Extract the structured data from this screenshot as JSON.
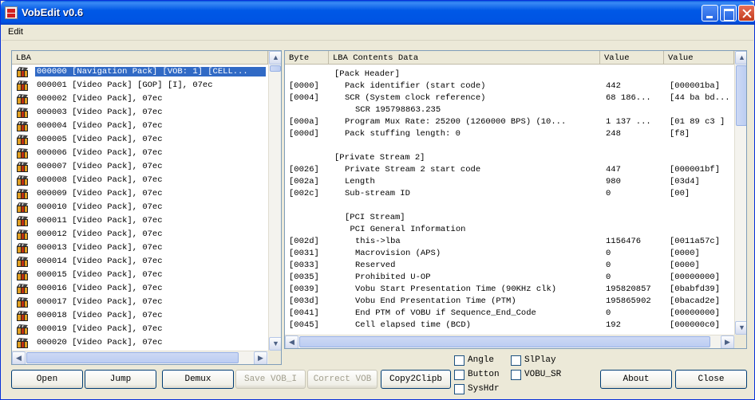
{
  "window": {
    "title": "VobEdit v0.6"
  },
  "menu": {
    "edit": "Edit"
  },
  "lba_panel": {
    "header": "LBA",
    "rows": [
      "000000 [Navigation Pack] [VOB: 1] [CELL...",
      "000001 [Video Pack] [GOP] [I], 07ec",
      "000002 [Video Pack], 07ec",
      "000003 [Video Pack], 07ec",
      "000004 [Video Pack], 07ec",
      "000005 [Video Pack], 07ec",
      "000006 [Video Pack], 07ec",
      "000007 [Video Pack], 07ec",
      "000008 [Video Pack], 07ec",
      "000009 [Video Pack], 07ec",
      "000010 [Video Pack], 07ec",
      "000011 [Video Pack], 07ec",
      "000012 [Video Pack], 07ec",
      "000013 [Video Pack], 07ec",
      "000014 [Video Pack], 07ec",
      "000015 [Video Pack], 07ec",
      "000016 [Video Pack], 07ec",
      "000017 [Video Pack], 07ec",
      "000018 [Video Pack], 07ec",
      "000019 [Video Pack], 07ec",
      "000020 [Video Pack], 07ec"
    ]
  },
  "contents_panel": {
    "headers": {
      "byte": "Byte",
      "contents": "LBA Contents Data",
      "value1": "Value",
      "value2": "Value"
    },
    "rows": [
      {
        "byte": "",
        "content": "[Pack Header]",
        "v1": "",
        "v2": "",
        "indent": 0
      },
      {
        "byte": "[0000]",
        "content": "Pack identifier (start code)",
        "v1": "442",
        "v2": "[000001ba]",
        "indent": 2
      },
      {
        "byte": "[0004]",
        "content": "SCR (System clock reference)",
        "v1": "68 186...",
        "v2": "[44 ba bd...",
        "indent": 2
      },
      {
        "byte": "",
        "content": "SCR 195798863.235",
        "v1": "",
        "v2": "",
        "indent": 4
      },
      {
        "byte": "[000a]",
        "content": "Program Mux Rate: 25200 (1260000 BPS) (10...",
        "v1": "1 137 ...",
        "v2": "[01 89 c3 ]",
        "indent": 2
      },
      {
        "byte": "[000d]",
        "content": "Pack stuffing length: 0",
        "v1": "248",
        "v2": "[f8]",
        "indent": 2
      },
      {
        "byte": "",
        "content": "",
        "v1": "",
        "v2": "",
        "indent": 0
      },
      {
        "byte": "",
        "content": "[Private Stream 2]",
        "v1": "",
        "v2": "",
        "indent": 0
      },
      {
        "byte": "[0026]",
        "content": "Private Stream 2 start code",
        "v1": "447",
        "v2": "[000001bf]",
        "indent": 2
      },
      {
        "byte": "[002a]",
        "content": "Length",
        "v1": "980",
        "v2": "[03d4]",
        "indent": 2
      },
      {
        "byte": "[002c]",
        "content": "Sub-stream ID",
        "v1": "0",
        "v2": "[00]",
        "indent": 2
      },
      {
        "byte": "",
        "content": "",
        "v1": "",
        "v2": "",
        "indent": 0
      },
      {
        "byte": "",
        "content": "[PCI Stream]",
        "v1": "",
        "v2": "",
        "indent": 2
      },
      {
        "byte": "",
        "content": "PCI General Information",
        "v1": "",
        "v2": "",
        "indent": 3
      },
      {
        "byte": "[002d]",
        "content": "this->lba",
        "v1": "1156476",
        "v2": "[0011a57c]",
        "indent": 4
      },
      {
        "byte": "[0031]",
        "content": "Macrovision (APS)",
        "v1": "0",
        "v2": "[0000]",
        "indent": 4
      },
      {
        "byte": "[0033]",
        "content": "Reserved",
        "v1": "0",
        "v2": "[0000]",
        "indent": 4
      },
      {
        "byte": "[0035]",
        "content": "Prohibited U-OP",
        "v1": "0",
        "v2": "[00000000]",
        "indent": 4
      },
      {
        "byte": "[0039]",
        "content": "Vobu Start Presentation Time (90KHz clk)",
        "v1": "195820857",
        "v2": "[0babfd39]",
        "indent": 4
      },
      {
        "byte": "[003d]",
        "content": "Vobu End Presentation Time (PTM)",
        "v1": "195865902",
        "v2": "[0bacad2e]",
        "indent": 4
      },
      {
        "byte": "[0041]",
        "content": "End PTM of VOBU if Sequence_End_Code",
        "v1": "0",
        "v2": "[00000000]",
        "indent": 4
      },
      {
        "byte": "[0045]",
        "content": "Cell elapsed time (BCD)",
        "v1": "192",
        "v2": "[000000c0]",
        "indent": 4
      }
    ]
  },
  "checkboxes": [
    {
      "label": "Angle"
    },
    {
      "label": "SlPlay"
    },
    {
      "label": "Button"
    },
    {
      "label": "VOBU_SR"
    },
    {
      "label": "SysHdr"
    }
  ],
  "buttons": {
    "open": "Open",
    "jump": "Jump",
    "demux": "Demux",
    "save_vob": "Save VOB_I",
    "correct_vob": "Correct VOB",
    "copy2clip": "Copy2Clipb",
    "about": "About",
    "close": "Close"
  }
}
